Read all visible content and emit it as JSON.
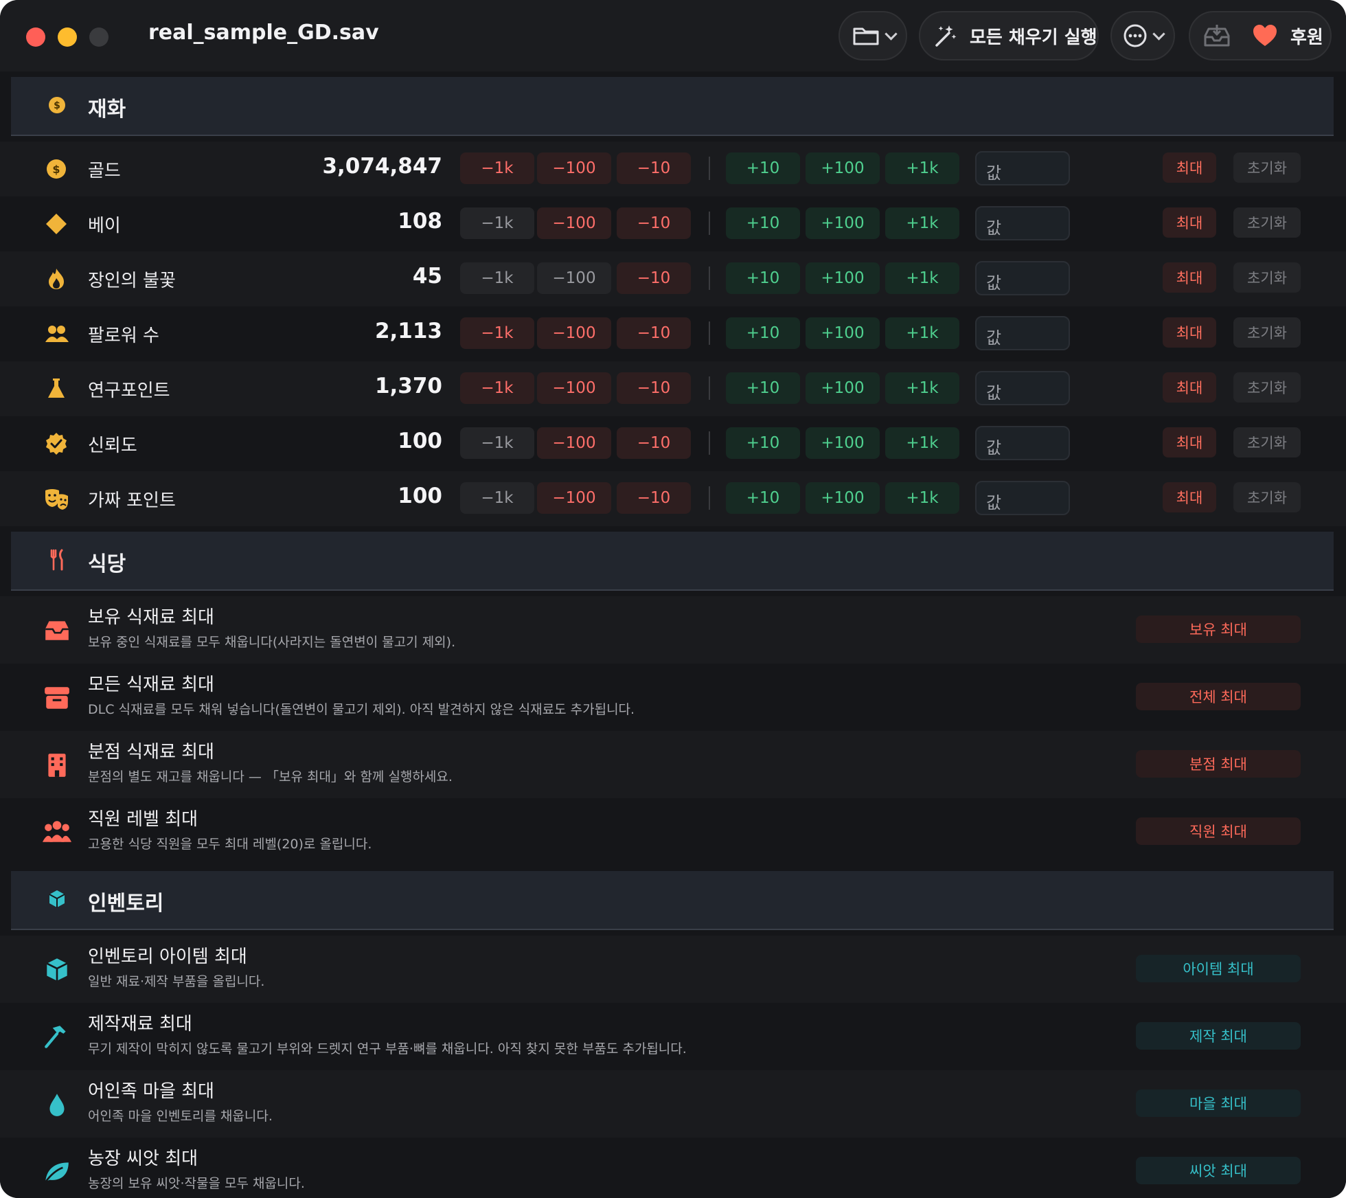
{
  "window": {
    "title": "real_sample_GD.sav"
  },
  "toolbar": {
    "fill_all_label": "모든 채우기 실행",
    "donate_label": "후원"
  },
  "colors": {
    "accent_red": "#ff6f6a",
    "accent_green": "#4fd08f",
    "accent_teal": "#36c0c9",
    "gold": "#f0b43a"
  },
  "currency": {
    "title": "재화",
    "controls": {
      "minus_1k": "−1k",
      "minus_100": "−100",
      "minus_10": "−10",
      "plus_10": "+10",
      "plus_100": "+100",
      "plus_1k": "+1k",
      "value_placeholder": "값",
      "max_label": "최대",
      "reset_label": "초기화"
    },
    "rows": [
      {
        "name": "골드",
        "value": "3,074,847",
        "icon": "coin-icon"
      },
      {
        "name": "베이",
        "value": "108",
        "icon": "diamond-icon"
      },
      {
        "name": "장인의 불꽃",
        "value": "45",
        "icon": "flame-icon"
      },
      {
        "name": "팔로워 수",
        "value": "2,113",
        "icon": "followers-icon"
      },
      {
        "name": "연구포인트",
        "value": "1,370",
        "icon": "flask-icon"
      },
      {
        "name": "신뢰도",
        "value": "100",
        "icon": "verified-badge-icon"
      },
      {
        "name": "가짜 포인트",
        "value": "100",
        "icon": "theater-masks-icon"
      }
    ]
  },
  "restaurant": {
    "title": "식당",
    "rows": [
      {
        "title": "보유 식재료 최대",
        "desc": "보유 중인 식재료를 모두 채웁니다(사라지는 돌연변이 물고기 제외).",
        "button": "보유 최대",
        "icon": "tray-icon"
      },
      {
        "title": "모든 식재료 최대",
        "desc": "DLC 식재료를 모두 채워 넣습니다(돌연변이 물고기 제외). 아직 발견하지 않은 식재료도 추가됩니다.",
        "button": "전체 최대",
        "icon": "archive-box-icon"
      },
      {
        "title": "분점 식재료 최대",
        "desc": "분점의 별도 재고를 채웁니다 — 「보유 최대」와 함께 실행하세요.",
        "button": "분점 최대",
        "icon": "building-icon"
      },
      {
        "title": "직원 레벨 최대",
        "desc": "고용한 식당 직원을 모두 최대 레벨(20)로 올립니다.",
        "button": "직원 최대",
        "icon": "staff-group-icon"
      }
    ]
  },
  "inventory": {
    "title": "인벤토리",
    "rows": [
      {
        "title": "인벤토리 아이템 최대",
        "desc": "일반 재료·제작 부품을 올립니다.",
        "button": "아이템 최대",
        "icon": "cube-icon"
      },
      {
        "title": "제작재료 최대",
        "desc": "무기 제작이 막히지 않도록 물고기 부위와 드렛지 연구 부품·뼈를 채웁니다. 아직 찾지 못한 부품도 추가됩니다.",
        "button": "제작 최대",
        "icon": "hammer-icon"
      },
      {
        "title": "어인족 마을 최대",
        "desc": "어인족 마을 인벤토리를 채웁니다.",
        "button": "마을 최대",
        "icon": "water-drop-icon"
      },
      {
        "title": "농장 씨앗 최대",
        "desc": "농장의 보유 씨앗·작물을 모두 채웁니다.",
        "button": "씨앗 최대",
        "icon": "leaf-icon"
      }
    ]
  }
}
